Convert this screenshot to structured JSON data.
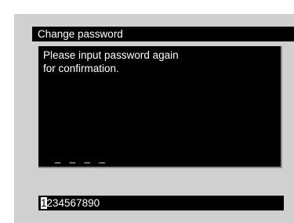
{
  "dialog": {
    "title": "Change password",
    "message_line_1": "Please input password again",
    "message_line_2": "for confirmation.",
    "password_placeholder": "_ _ _ _"
  },
  "character_bar": {
    "selected_character": "1",
    "remaining_characters": "234567890"
  }
}
